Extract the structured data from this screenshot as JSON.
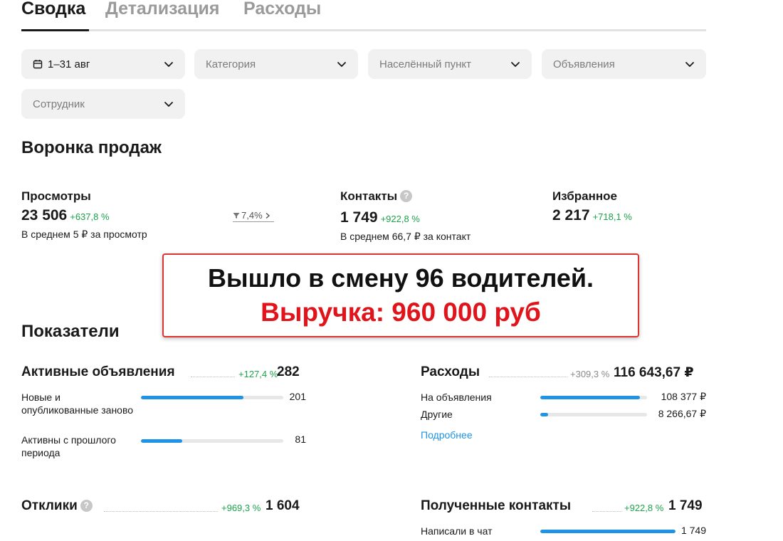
{
  "tabs": [
    {
      "label": "Сводка",
      "active": true
    },
    {
      "label": "Детализация",
      "active": false
    },
    {
      "label": "Расходы",
      "active": false
    }
  ],
  "filters": {
    "date": "1–31 авг",
    "category": "Категория",
    "locality": "Населённый пункт",
    "ads": "Объявления",
    "employee": "Сотрудник"
  },
  "funnel": {
    "title": "Воронка продаж",
    "views": {
      "label": "Просмотры",
      "value": "23 506",
      "delta": "+637,8 %",
      "sub": "В среднем 5 ₽ за просмотр"
    },
    "conversion": "7,4%",
    "contacts": {
      "label": "Контакты",
      "value": "1 749",
      "delta": "+922,8 %",
      "sub": "В среднем 66,7 ₽ за контакт"
    },
    "favorites": {
      "label": "Избранное",
      "value": "2 217",
      "delta": "+718,1 %"
    }
  },
  "banner": {
    "line1": "Вышло в смену 96 водителей.",
    "line2": "Выручка: 960 000 руб"
  },
  "indicators": {
    "title": "Показатели",
    "active_ads": {
      "title": "Активные объявления",
      "delta": "+127,4 %",
      "total": "282",
      "rows": [
        {
          "label": "Новые и опубликованные заново",
          "value": "201",
          "fill": 0.72
        },
        {
          "label": "Активны с прошлого периода",
          "value": "81",
          "fill": 0.29
        }
      ]
    },
    "expenses": {
      "title": "Расходы",
      "delta": "+309,3 %",
      "total": "116 643,67 ₽",
      "rows": [
        {
          "label": "На объявления",
          "value": "108 377 ₽",
          "fill": 0.93
        },
        {
          "label": "Другие",
          "value": "8 266,67 ₽",
          "fill": 0.07
        }
      ],
      "link": "Подробнее"
    },
    "responses": {
      "title": "Отклики",
      "delta": "+969,3 %",
      "total": "1 604"
    },
    "received_contacts": {
      "title": "Полученные контакты",
      "delta": "+922,8 %",
      "total": "1 749",
      "rows": [
        {
          "label": "Написали в чат",
          "value": "1 749",
          "fill": 1.0
        }
      ]
    }
  },
  "colors": {
    "accent": "#1f93e6",
    "positive": "#1aa34a",
    "banner_red": "#e0141a"
  },
  "icons": {
    "calendar": "calendar-icon",
    "chevron": "chevron-down-icon",
    "help": "help-icon",
    "funnel": "funnel-icon"
  }
}
